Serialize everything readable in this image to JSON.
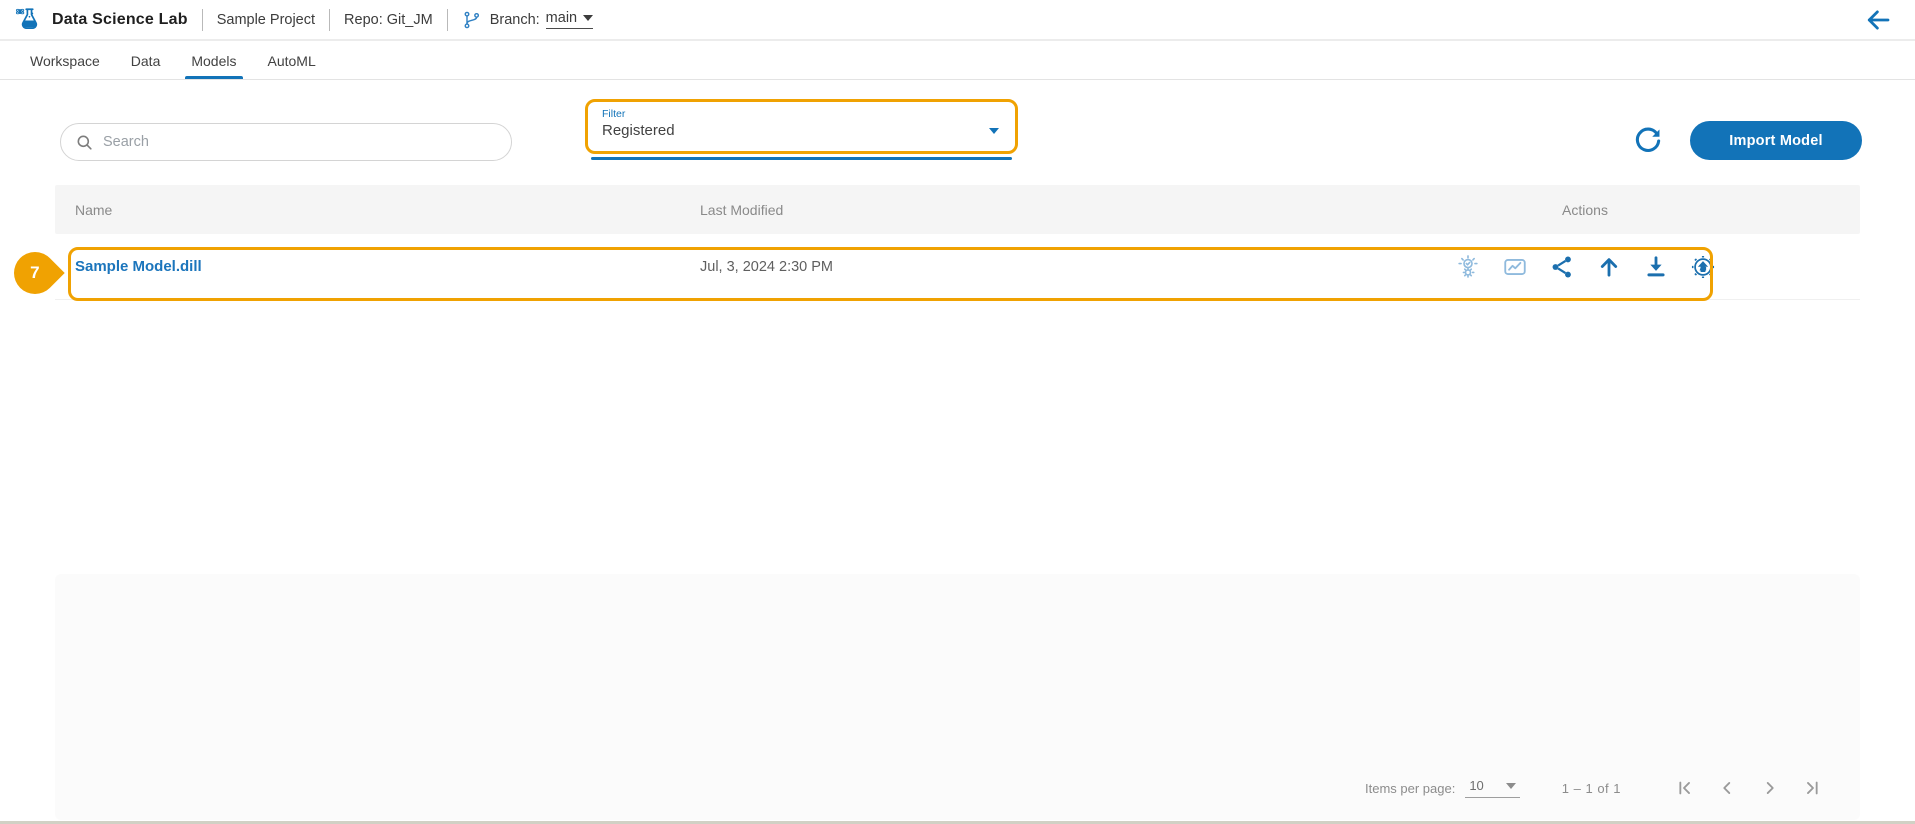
{
  "header": {
    "app_title": "Data Science Lab",
    "project_name": "Sample Project",
    "repo_label": "Repo: Git_JM",
    "branch_label": "Branch:",
    "branch_value": "main"
  },
  "tabs": [
    {
      "label": "Workspace",
      "active": false
    },
    {
      "label": "Data",
      "active": false
    },
    {
      "label": "Models",
      "active": true
    },
    {
      "label": "AutoML",
      "active": false
    }
  ],
  "toolbar": {
    "search_placeholder": "Search",
    "filter_label": "Filter",
    "filter_value": "Registered",
    "import_button_label": "Import Model"
  },
  "table": {
    "columns": [
      "Name",
      "Last Modified",
      "Actions"
    ],
    "rows": [
      {
        "name": "Sample Model.dill",
        "last_modified": "Jul, 3, 2024 2:30 PM",
        "action_icons": [
          "insights-bulb-gear",
          "model-monitor-chart",
          "share",
          "promote-up-arrow",
          "download",
          "deploy-api-gear"
        ]
      }
    ]
  },
  "annotations": {
    "row_step_badge": "7",
    "highlight_color": "#F0A202"
  },
  "pagination": {
    "items_per_page_label": "Items per page:",
    "items_per_page_value": "10",
    "range_label": "1 – 1 of 1",
    "nav_icons": [
      "first-page",
      "previous-page",
      "next-page",
      "last-page"
    ]
  },
  "icons": {
    "logo": "flask-atom",
    "branch": "git-branch",
    "back": "arrow-left",
    "search": "magnifier",
    "refresh": "refresh-circular-arrow",
    "carets": "caret-down"
  },
  "colors": {
    "primary_blue": "#1273B8",
    "link_blue": "#1B75BC",
    "light_icon_blue": "#8FBADD",
    "dark_icon_blue": "#1B6FAE",
    "annotation_orange": "#F0A202",
    "muted_text": "#8A8A8A"
  }
}
